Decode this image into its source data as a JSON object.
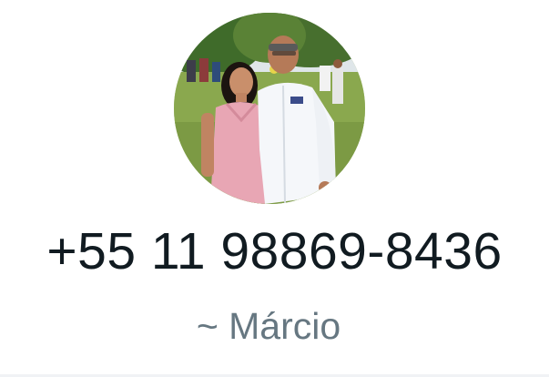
{
  "profile": {
    "avatar_icon": "profile-photo",
    "phone_number": "+55 11 98869-8436",
    "display_name": "~ Márcio"
  },
  "colors": {
    "primary_text": "#111b21",
    "secondary_text": "#667781",
    "background": "#ffffff"
  }
}
